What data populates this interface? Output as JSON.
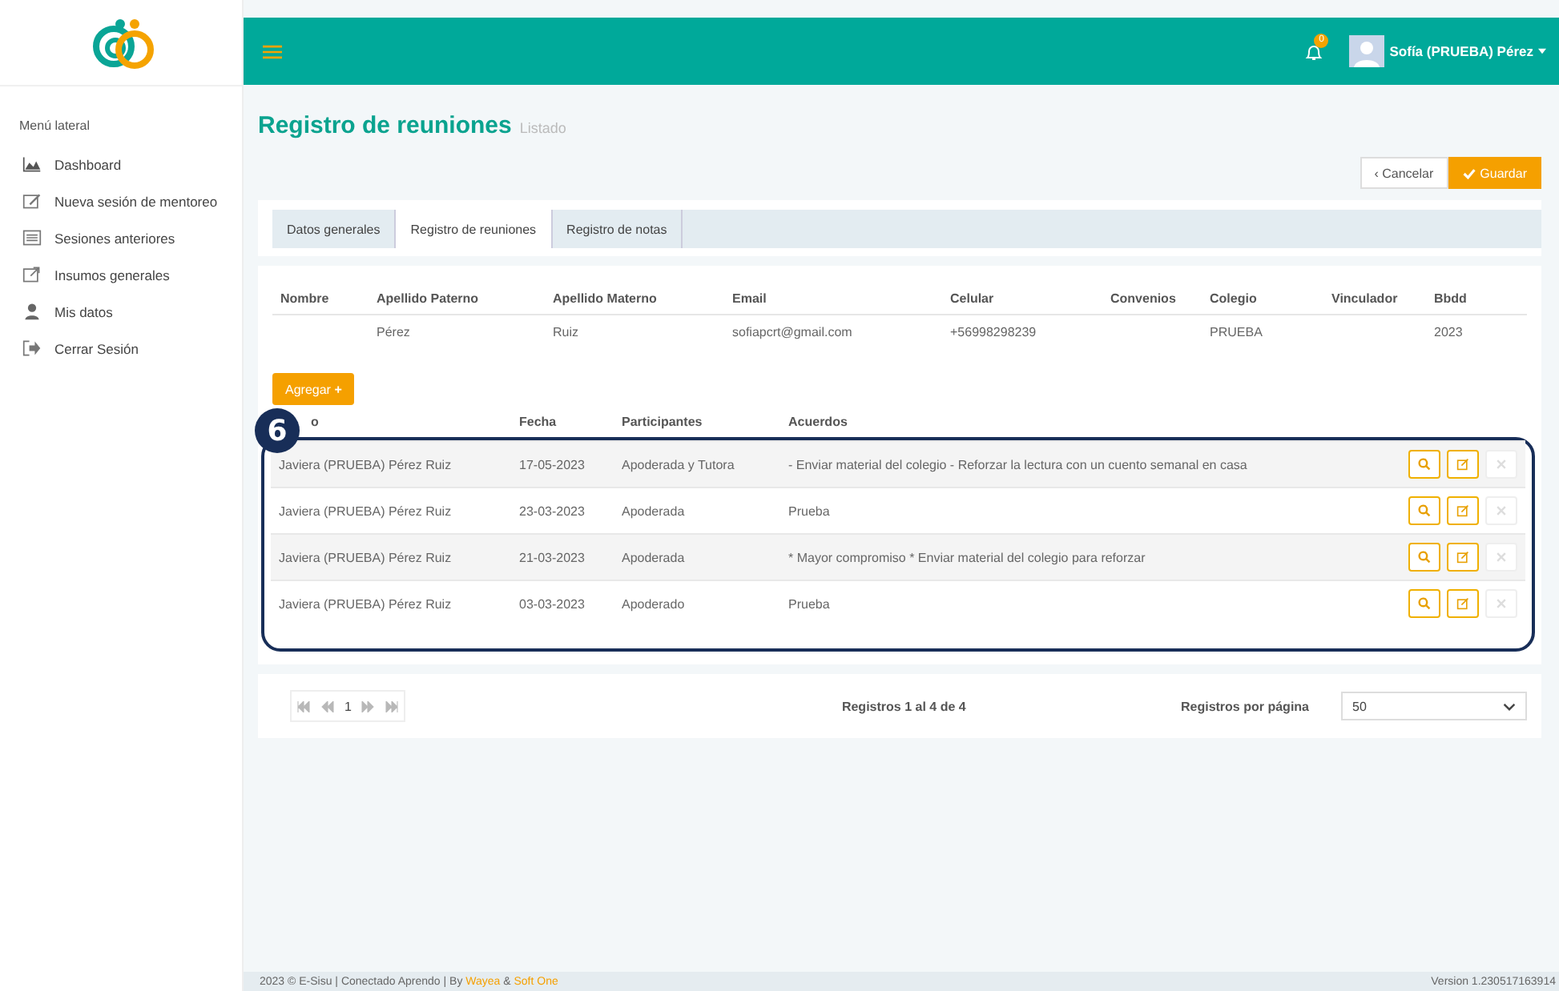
{
  "sidebar": {
    "heading": "Menú lateral",
    "items": [
      {
        "label": "Dashboard",
        "kind": "chart"
      },
      {
        "label": "Nueva sesión de mentoreo",
        "kind": "edit"
      },
      {
        "label": "Sesiones anteriores",
        "kind": "list"
      },
      {
        "label": "Insumos generales",
        "kind": "external"
      },
      {
        "label": "Mis datos",
        "kind": "user"
      },
      {
        "label": "Cerrar Sesión",
        "kind": "logout"
      }
    ]
  },
  "topbar": {
    "notification_count": "0",
    "user_name": "Sofía (PRUEBA) Pérez"
  },
  "page": {
    "title": "Registro de reuniones",
    "subtitle": "Listado"
  },
  "actions": {
    "cancel_icon": "‹",
    "cancel": "Cancelar",
    "save": "Guardar"
  },
  "tabs": [
    {
      "label": "Datos generales",
      "selected": false
    },
    {
      "label": "Registro de reuniones",
      "selected": true
    },
    {
      "label": "Registro de notas",
      "selected": false
    }
  ],
  "student": {
    "columns": [
      "Nombre",
      "Apellido Paterno",
      "Apellido Materno",
      "Email",
      "Celular",
      "Convenios",
      "Colegio",
      "Vinculador",
      "Bbdd"
    ],
    "row": {
      "column_2": "Pérez",
      "column_3": "Ruiz",
      "column_4": "sofiapcrt@gmail.com",
      "column_5": "+56998298239",
      "column_7": "PRUEBA",
      "column_9": "2023"
    }
  },
  "add_button": "Agregar",
  "add_icon": "+",
  "annotation": {
    "number": "6"
  },
  "meetings": {
    "columns": [
      "o",
      "Fecha",
      "Participantes",
      "Acuerdos"
    ],
    "rows": [
      {
        "cells": [
          "Javiera (PRUEBA) Pérez Ruiz",
          "17-05-2023",
          "Apoderada y Tutora",
          "- Enviar material del colegio - Reforzar la lectura con un cuento semanal en casa"
        ],
        "delete_disabled": true
      },
      {
        "cells": [
          "Javiera (PRUEBA) Pérez Ruiz",
          "23-03-2023",
          "Apoderada",
          "Prueba"
        ],
        "delete_disabled": true
      },
      {
        "cells": [
          "Javiera (PRUEBA) Pérez Ruiz",
          "21-03-2023",
          "Apoderada",
          "* Mayor compromiso * Enviar material del colegio para reforzar"
        ],
        "delete_disabled": true
      },
      {
        "cells": [
          "Javiera (PRUEBA) Pérez Ruiz",
          "03-03-2023",
          "Apoderado",
          "Prueba"
        ],
        "delete_disabled": true
      }
    ]
  },
  "pagination": {
    "page": "1",
    "summary": "Registros 1 al 4 de 4",
    "per_page_label": "Registros por página",
    "per_page": "50",
    "nav_disabled": true
  },
  "footer": {
    "text": "2023 © E-Sisu | Conectado Aprendo | By",
    "link_1": "Wayea",
    "separator": "&",
    "link_2": "Soft One",
    "version": "Version 1.230517163914"
  }
}
